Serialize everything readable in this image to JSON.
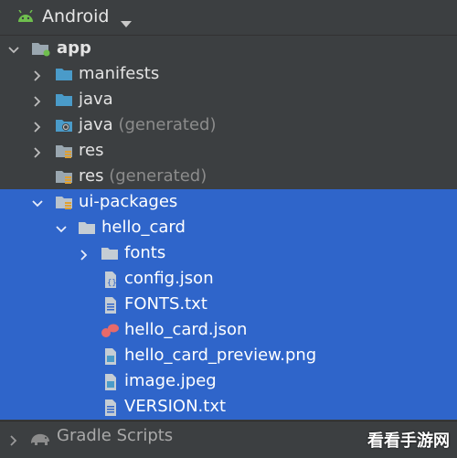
{
  "header": {
    "title": "Android",
    "icon": "android-icon",
    "caret_icon": "chevron-down-icon"
  },
  "tree": [
    {
      "label": "app",
      "icon": "module-folder-icon",
      "expanded": true,
      "selected": false
    },
    {
      "label": "manifests",
      "icon": "folder-icon",
      "expanded": false,
      "selected": false
    },
    {
      "label": "java",
      "icon": "source-folder-icon",
      "expanded": false,
      "selected": false
    },
    {
      "label": "java",
      "suffix": "(generated)",
      "icon": "generated-source-folder-icon",
      "expanded": false,
      "selected": false
    },
    {
      "label": "res",
      "icon": "resource-folder-icon",
      "expanded": false,
      "selected": false
    },
    {
      "label": "res",
      "suffix": "(generated)",
      "icon": "resource-folder-icon",
      "selected": false
    },
    {
      "label": "ui-packages",
      "icon": "resource-folder-icon",
      "expanded": true,
      "selected": true
    },
    {
      "label": "hello_card",
      "icon": "folder-icon",
      "expanded": true,
      "selected": true
    },
    {
      "label": "fonts",
      "icon": "folder-icon",
      "expanded": false,
      "selected": true
    },
    {
      "label": "config.json",
      "icon": "json-file-icon",
      "selected": true
    },
    {
      "label": "FONTS.txt",
      "icon": "text-file-icon",
      "selected": true
    },
    {
      "label": "hello_card.json",
      "icon": "figma-file-icon",
      "selected": true
    },
    {
      "label": "hello_card_preview.png",
      "icon": "image-file-icon",
      "selected": true
    },
    {
      "label": "image.jpeg",
      "icon": "image-file-icon",
      "selected": true
    },
    {
      "label": "VERSION.txt",
      "icon": "text-file-icon",
      "selected": true
    }
  ],
  "footer": {
    "label": "Gradle Scripts",
    "icon": "gradle-elephant-icon"
  },
  "watermark": "看看手游网",
  "colors": {
    "background": "#3c3f41",
    "selection": "#2f65ca",
    "folder": "#4a9bc9",
    "android": "#6fbf4e",
    "figma": "#e86a6a"
  }
}
